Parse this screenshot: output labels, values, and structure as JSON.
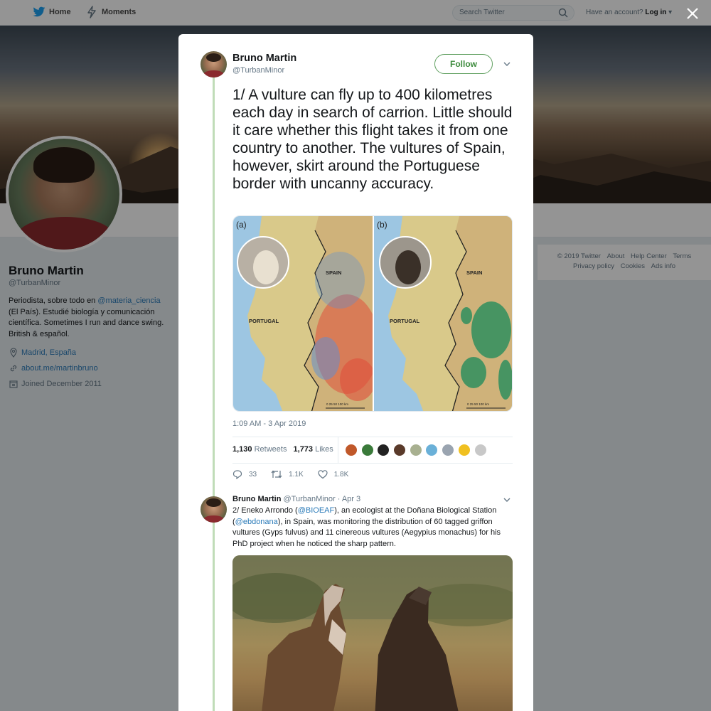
{
  "nav": {
    "home_label": "Home",
    "moments_label": "Moments",
    "search_placeholder": "Search Twitter",
    "have_account": "Have an account?",
    "login_label": "Log in"
  },
  "profile": {
    "name": "Bruno Martin",
    "handle": "@TurbanMinor",
    "bio_before": "Periodista, sobre todo en ",
    "bio_mention": "@materia_ciencia",
    "bio_after": " (El País). Estudié biología y comunicación científica. Sometimes I run and dance swing. British & español.",
    "location": "Madrid, España",
    "website": "about.me/martinbruno",
    "joined": "Joined December 2011"
  },
  "footer": {
    "copyright": "© 2019 Twitter",
    "about": "About",
    "help": "Help Center",
    "terms": "Terms",
    "privacy": "Privacy policy",
    "cookies": "Cookies",
    "ads": "Ads info"
  },
  "tweet": {
    "author_name": "Bruno Martin",
    "author_handle": "@TurbanMinor",
    "follow_label": "Follow",
    "text": "1/ A vulture can fly up to 400 kilometres each day in search of carrion. Little should it care whether this flight takes it from one country to another. The vultures of Spain, however, skirt around the Portuguese border with uncanny accuracy.",
    "map": {
      "panel_a_label": "(a)",
      "panel_b_label": "(b)",
      "spain_label": "SPAIN",
      "portugal_label": "PORTUGAL",
      "scale_label": "0   25   50        100 km"
    },
    "timestamp": "1:09 AM - 3 Apr 2019",
    "retweets_count": "1,130",
    "retweets_label": "Retweets",
    "likes_count": "1,773",
    "likes_label": "Likes",
    "reply_count": "33",
    "retweet_count_short": "1.1K",
    "like_count_short": "1.8K"
  },
  "reply": {
    "author_name": "Bruno Martin",
    "author_handle": "@TurbanMinor",
    "date": "· Apr 3",
    "text_1": "2/ Eneko Arrondo (",
    "mention_1": "@BIOEAF",
    "text_2": "), an ecologist at the Doñana Biological Station (",
    "mention_2": "@ebdonana",
    "text_3": "), in Spain, was monitoring the distribution of 60 tagged griffon vultures (Gyps fulvus) and 11 cinereous vultures (Aegypius monachus) for his PhD project when he noticed the sharp pattern."
  },
  "colors": {
    "link": "#2b7bb9",
    "follow": "#3d8b3d",
    "thread_line": "#c0dcb8",
    "griffon_points": "#e0503a",
    "cinereous_points": "#1a8a5a"
  }
}
